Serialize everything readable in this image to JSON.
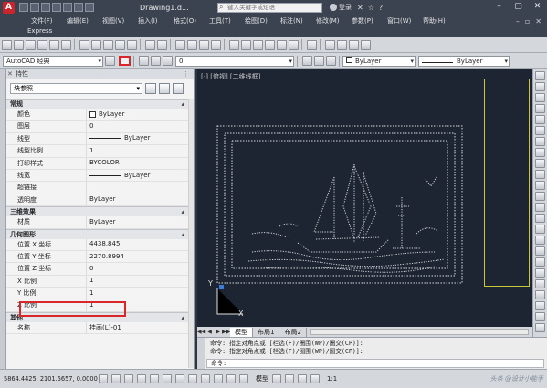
{
  "titlebar": {
    "app_letter": "A",
    "title": "Drawing1.d...",
    "search_placeholder": "键入关键字或短语",
    "user_label": "登录",
    "help_label": "?"
  },
  "menu": [
    "文件(F)",
    "编辑(E)",
    "视图(V)",
    "插入(I)",
    "格式(O)",
    "工具(T)",
    "绘图(D)",
    "标注(N)",
    "修改(M)",
    "参数(P)",
    "窗口(W)",
    "帮助(H)"
  ],
  "express_label": "Express",
  "toolbar": {
    "workspace": "AutoCAD 经典",
    "layer": "0",
    "color": "ByLayer",
    "linetype": "ByLayer"
  },
  "palette": {
    "title": "特性",
    "selection": "块参照",
    "groups": [
      {
        "name": "常规",
        "rows": [
          {
            "key": "颜色",
            "value": "ByLayer",
            "mark": "swatch"
          },
          {
            "key": "图层",
            "value": "0",
            "mark": ""
          },
          {
            "key": "线型",
            "value": "ByLayer",
            "mark": "line"
          },
          {
            "key": "线型比例",
            "value": "1",
            "mark": ""
          },
          {
            "key": "打印样式",
            "value": "BYCOLOR",
            "mark": ""
          },
          {
            "key": "线宽",
            "value": "ByLayer",
            "mark": "line"
          },
          {
            "key": "超链接",
            "value": "",
            "mark": ""
          },
          {
            "key": "透明度",
            "value": "ByLayer",
            "mark": ""
          }
        ]
      },
      {
        "name": "三维效果",
        "rows": [
          {
            "key": "材质",
            "value": "ByLayer",
            "mark": ""
          }
        ]
      },
      {
        "name": "几何图形",
        "rows": [
          {
            "key": "位置 X 坐标",
            "value": "4438.845",
            "mark": ""
          },
          {
            "key": "位置 Y 坐标",
            "value": "2270.8994",
            "mark": ""
          },
          {
            "key": "位置 Z 坐标",
            "value": "0",
            "mark": ""
          },
          {
            "key": "X 比例",
            "value": "1",
            "mark": ""
          },
          {
            "key": "Y 比例",
            "value": "1",
            "mark": ""
          },
          {
            "key": "Z 比例",
            "value": "1",
            "mark": ""
          }
        ]
      },
      {
        "name": "其他",
        "rows": [
          {
            "key": "名称",
            "value": "挂画(L)-01",
            "mark": ""
          }
        ]
      }
    ]
  },
  "viewport": {
    "label": "[-] [俯视] [二维线框]",
    "ucs_y": "Y",
    "ucs_x": "X"
  },
  "layout_tabs": [
    "模型",
    "布局1",
    "布局2"
  ],
  "command": {
    "lines": [
      "命令: 指定对角点或 [栏选(F)/圈围(WP)/圈交(CP)]:",
      "命令: 指定对角点或 [栏选(F)/圈围(WP)/圈交(CP)]:"
    ],
    "prompt": "命令:"
  },
  "status": {
    "coords": "5864.4425, 2101.5657, 0.0000",
    "model": "模型",
    "scale": "1:1",
    "watermark": "头条 @设计小能手"
  },
  "colors": {
    "canvas": "#1d2533",
    "highlight": "#d8262b",
    "frame": "#c9c83a",
    "chrome": "#3b4250"
  },
  "icons": [
    "app-logo-icon",
    "search-icon",
    "user-icon",
    "help-icon",
    "minimize-icon",
    "maximize-icon",
    "close-icon",
    "drawing-pin-icon",
    "ucs-icon"
  ]
}
